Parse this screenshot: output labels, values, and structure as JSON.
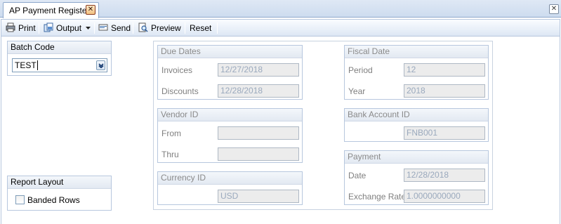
{
  "tab": {
    "title": "AP Payment Register",
    "close_glyph": "✕"
  },
  "window": {
    "close_glyph": "✕"
  },
  "toolbar": {
    "print": "Print",
    "output": "Output",
    "send": "Send",
    "preview": "Preview",
    "reset": "Reset"
  },
  "batch": {
    "label": "Batch Code",
    "value": "TEST"
  },
  "report_layout": {
    "label": "Report Layout",
    "banded_rows": "Banded Rows",
    "banded_checked": false
  },
  "due_dates": {
    "label": "Due Dates",
    "invoices_label": "Invoices",
    "invoices_value": "12/27/2018",
    "discounts_label": "Discounts",
    "discounts_value": "12/28/2018"
  },
  "vendor": {
    "label": "Vendor ID",
    "from_label": "From",
    "from_value": "",
    "thru_label": "Thru",
    "thru_value": ""
  },
  "currency": {
    "label": "Currency ID",
    "value": "USD"
  },
  "fiscal": {
    "label": "Fiscal Date",
    "period_label": "Period",
    "period_value": "12",
    "year_label": "Year",
    "year_value": "2018"
  },
  "bank": {
    "label": "Bank Account ID",
    "value": "FNB001"
  },
  "payment": {
    "label": "Payment",
    "date_label": "Date",
    "date_value": "12/28/2018",
    "rate_label": "Exchange Rate",
    "rate_value": "1.0000000000"
  },
  "colors": {
    "accent": "#8ea8cc",
    "disabled_field": "#ececec",
    "disabled_text": "#9aa9bd"
  }
}
